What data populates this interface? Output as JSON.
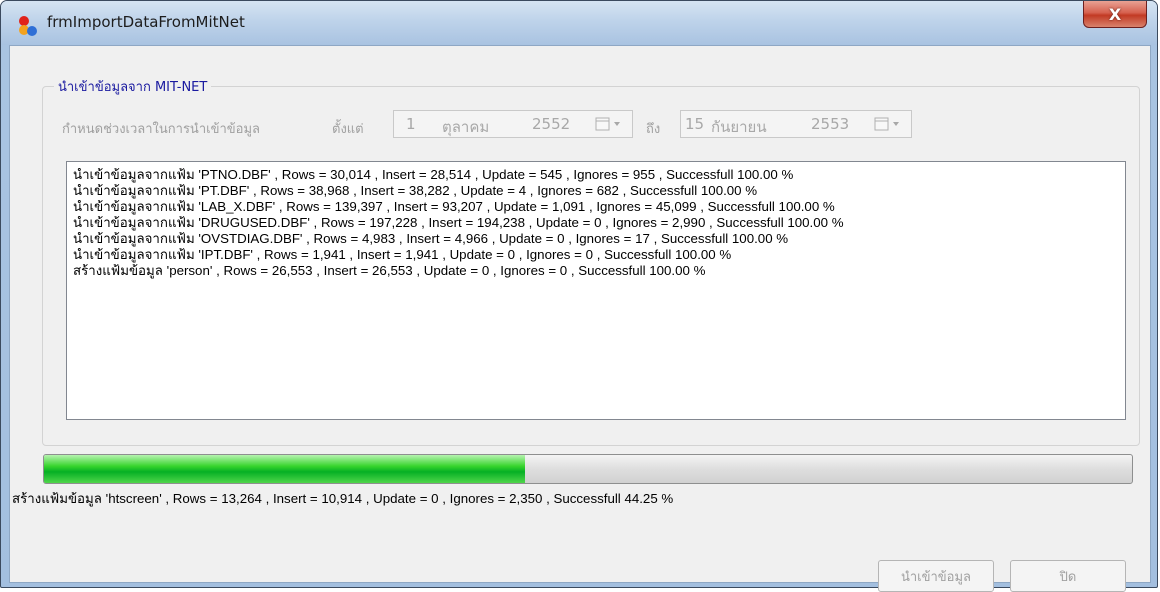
{
  "window": {
    "title": "frmImportDataFromMitNet",
    "close_label": "X"
  },
  "group": {
    "legend": "นำเข้าข้อมูลจาก MIT-NET",
    "range_label": "กำหนดช่วงเวลาในการนำเข้าข้อมูล",
    "from_label": "ตั้งแต่",
    "to_label": "ถึง",
    "from_date": {
      "day": "1",
      "month": "ตุลาคม",
      "year": "2552"
    },
    "to_date": {
      "day": "15",
      "month": "กันยายน",
      "year": "2553"
    }
  },
  "log": {
    "lines": [
      "นำเข้าข้อมูลจากแฟ้ม 'PTNO.DBF' , Rows = 30,014 , Insert = 28,514 , Update = 545 , Ignores = 955 , Successfull 100.00 %",
      "นำเข้าข้อมูลจากแฟ้ม 'PT.DBF' , Rows = 38,968 , Insert = 38,282 , Update = 4 , Ignores = 682 , Successfull 100.00 %",
      "นำเข้าข้อมูลจากแฟ้ม 'LAB_X.DBF' , Rows = 139,397 , Insert = 93,207 , Update = 1,091 , Ignores = 45,099 , Successfull 100.00 %",
      "นำเข้าข้อมูลจากแฟ้ม 'DRUGUSED.DBF' , Rows = 197,228 , Insert = 194,238 , Update = 0 , Ignores = 2,990 , Successfull 100.00 %",
      "นำเข้าข้อมูลจากแฟ้ม 'OVSTDIAG.DBF' , Rows = 4,983 , Insert = 4,966 , Update = 0 , Ignores = 17 , Successfull 100.00 %",
      "นำเข้าข้อมูลจากแฟ้ม 'IPT.DBF' , Rows = 1,941 , Insert = 1,941 , Update = 0 , Ignores = 0 , Successfull 100.00 %",
      "สร้างแฟ้มข้อมูล 'person' , Rows = 26,553 , Insert = 26,553 , Update = 0 , Ignores = 0 , Successfull 100.00 %"
    ]
  },
  "progress": {
    "fraction": 0.4425
  },
  "status": {
    "text": "สร้างแฟ้มข้อมูล 'htscreen' , Rows = 13,264 , Insert = 10,914 , Update = 0 , Ignores = 2,350 , Successfull 44.25 %"
  },
  "buttons": {
    "import_label": "นำเข้าข้อมูล",
    "close_label": "ปิด"
  },
  "icons": {
    "app": "app-logo-icon",
    "calendar": "calendar-dropdown-icon"
  },
  "colors": {
    "legend": "#1a1aa0",
    "progress": "#06b025",
    "close_button": "#c23a24"
  }
}
